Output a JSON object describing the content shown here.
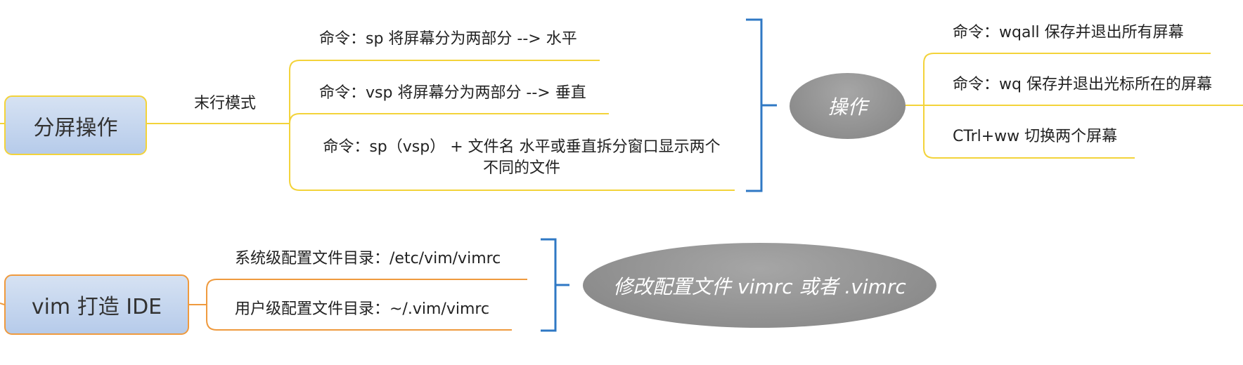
{
  "colors": {
    "yellow_branch": "#f3d33a",
    "orange_branch": "#ef9a3e",
    "bracket_blue": "#2f78c4",
    "node_fill": "#c7d8ef",
    "ellipse_fill": "#999999"
  },
  "split_screen": {
    "title": "分屏操作",
    "mode_label": "末行模式",
    "commands": [
      "命令：sp 将屏幕分为两部分 --> 水平",
      "命令：vsp 将屏幕分为两部分 --> 垂直",
      "命令：sp（vsp） + 文件名 水平或垂直拆分窗口显示两个不同的文件"
    ],
    "summary": "操作",
    "operations": [
      "命令：wqall 保存并退出所有屏幕",
      "命令：wq 保存并退出光标所在的屏幕",
      "CTrl+ww 切换两个屏幕"
    ]
  },
  "vim_ide": {
    "title": "vim 打造 IDE",
    "configs": [
      "系统级配置文件目录：/etc/vim/vimrc",
      "用户级配置文件目录：~/.vim/vimrc"
    ],
    "summary": "修改配置文件 vimrc 或者 .vimrc"
  }
}
